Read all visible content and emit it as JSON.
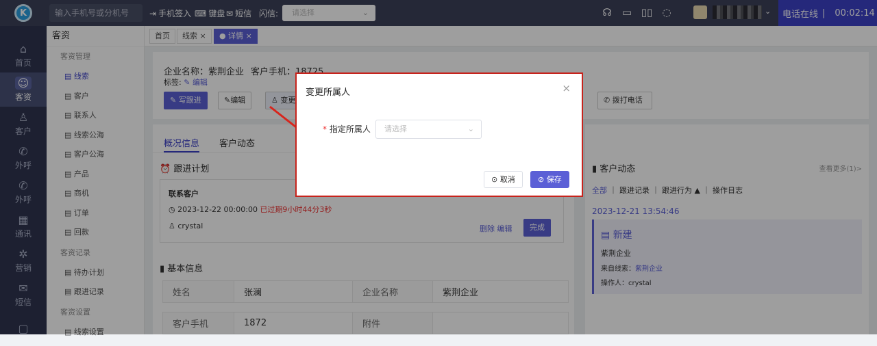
{
  "topbar": {
    "phone_placeholder": "输入手机号或分机号",
    "checkin": "手机签入",
    "keyboard": "键盘",
    "sms": "短信",
    "flash_label": "闪信:",
    "flash_placeholder": "请选择",
    "user_name": "c 、 ▪︎ ▪︎ '▪︎ 雲",
    "status": "电话在线",
    "timer": "00:02:14"
  },
  "sidebar": {
    "items": [
      {
        "label": "首页",
        "icon": "home-icon"
      },
      {
        "label": "客资",
        "icon": "users-icon"
      },
      {
        "label": "客户",
        "icon": "person-icon"
      },
      {
        "label": "外呼",
        "icon": "phone-out-icon"
      },
      {
        "label": "外呼",
        "icon": "phone-in-icon"
      },
      {
        "label": "通讯",
        "icon": "contacts-icon"
      },
      {
        "label": "营销",
        "icon": "gear-icon"
      },
      {
        "label": "短信",
        "icon": "mail-icon"
      }
    ]
  },
  "subnav": {
    "title": "客资",
    "group1": "客资管理",
    "items1": [
      "线索",
      "客户",
      "联系人",
      "线索公海",
      "客户公海",
      "产品",
      "商机",
      "订单",
      "回款"
    ],
    "group2": "客资记录",
    "items2": [
      "待办计划",
      "跟进记录"
    ],
    "group3": "客资设置",
    "items3": [
      "线索设置"
    ]
  },
  "tabs": {
    "home": "首页",
    "leads": "线索",
    "detail": "详情"
  },
  "detail": {
    "company_label": "企业名称：紫荆企业",
    "phone_label": "客户手机：18725",
    "tag_label": "标签:",
    "edit_tag": "编辑",
    "btn_write": "写跟进",
    "btn_edit": "编辑",
    "btn_change": "变更",
    "btn_call": "拨打电话",
    "tab_overview": "概况信息",
    "tab_activity": "客户动态",
    "plan_title": "跟进计划",
    "contact_title": "联系客户",
    "plan_time": "2023-12-22 00:00:00",
    "overdue": "已过期9小时44分3秒",
    "plan_user": "crystal",
    "delete": "删除",
    "edit": "编辑",
    "complete": "完成",
    "basic_title": "基本信息",
    "row1": [
      "姓名",
      "张澜",
      "企业名称",
      "紫荆企业"
    ],
    "row2": [
      "客户手机",
      "1872",
      "附件",
      ""
    ]
  },
  "activity": {
    "title": "客户动态",
    "more": "查看更多(1)>",
    "filters": [
      "全部",
      "跟进记录",
      "跟进行为 ▲",
      "操作日志"
    ],
    "time": "2023-12-21 13:54:46",
    "event": "新建",
    "company": "紫荆企业",
    "from_label": "来自线索：",
    "from_value": "紫荆企业",
    "operator": "操作人：crystal"
  },
  "modal": {
    "title": "变更所属人",
    "required": "*",
    "field_label": "指定所属人",
    "placeholder": "请选择",
    "cancel": "取消",
    "save": "保存"
  }
}
